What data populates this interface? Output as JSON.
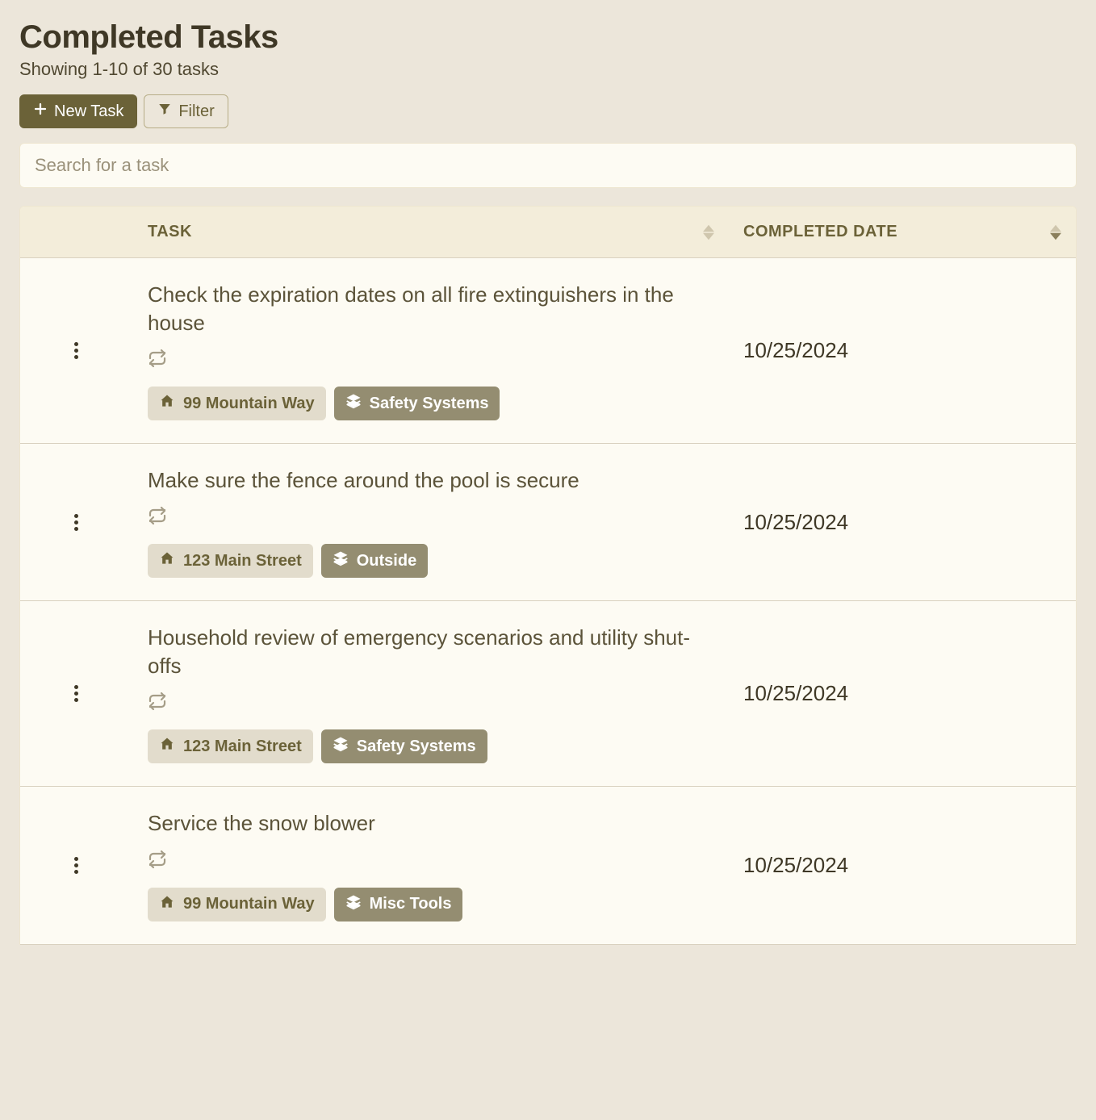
{
  "header": {
    "title": "Completed Tasks",
    "subtitle": "Showing 1-10 of 30 tasks"
  },
  "toolbar": {
    "new_task_label": "New Task",
    "filter_label": "Filter"
  },
  "search": {
    "placeholder": "Search for a task"
  },
  "table": {
    "columns": {
      "task": "TASK",
      "completed_date": "COMPLETED DATE"
    },
    "rows": [
      {
        "title": "Check the expiration dates on all fire extinguishers in the house",
        "recurring": true,
        "property": "99 Mountain Way",
        "category": "Safety Systems",
        "completed_date": "10/25/2024"
      },
      {
        "title": "Make sure the fence around the pool is secure",
        "recurring": true,
        "property": "123 Main Street",
        "category": "Outside",
        "completed_date": "10/25/2024"
      },
      {
        "title": "Household review of emergency scenarios and utility shut-offs",
        "recurring": true,
        "property": "123 Main Street",
        "category": "Safety Systems",
        "completed_date": "10/25/2024"
      },
      {
        "title": "Service the snow blower",
        "recurring": true,
        "property": "99 Mountain Way",
        "category": "Misc Tools",
        "completed_date": "10/25/2024"
      }
    ]
  }
}
